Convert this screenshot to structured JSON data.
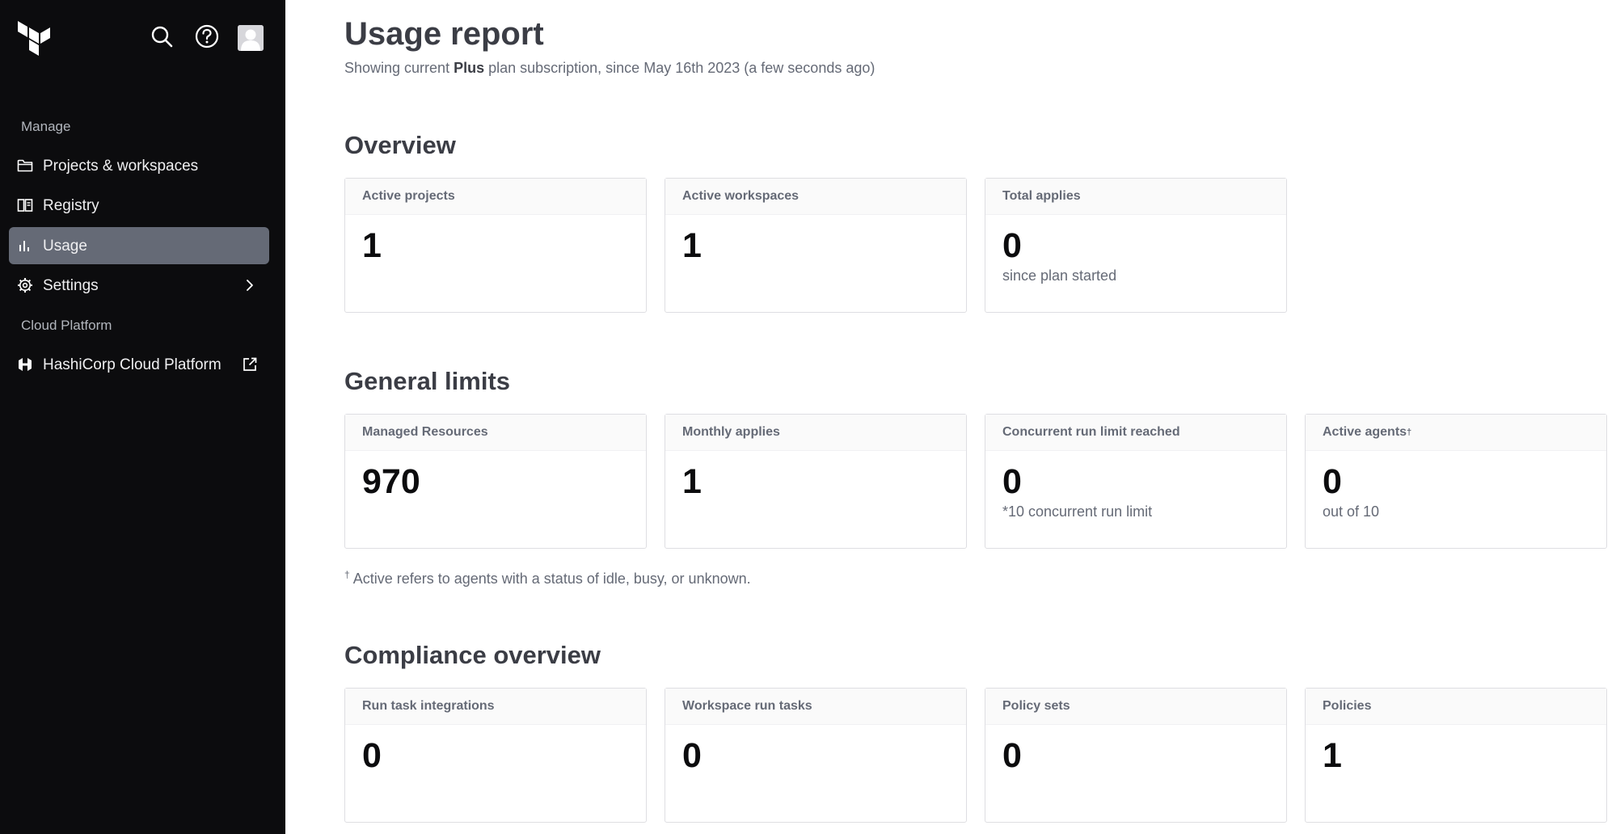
{
  "sidebar": {
    "manage_label": "Manage",
    "items": [
      {
        "label": "Projects & workspaces"
      },
      {
        "label": "Registry"
      },
      {
        "label": "Usage"
      },
      {
        "label": "Settings"
      }
    ],
    "cloud_label": "Cloud Platform",
    "cloud_item": {
      "label": "HashiCorp Cloud Platform"
    }
  },
  "header": {
    "title": "Usage report",
    "subtitle_prefix": "Showing current ",
    "plan": "Plus",
    "subtitle_suffix": " plan subscription, since May 16th 2023 (a few seconds ago)"
  },
  "overview": {
    "title": "Overview",
    "cards": [
      {
        "label": "Active projects",
        "value": "1",
        "note": ""
      },
      {
        "label": "Active workspaces",
        "value": "1",
        "note": ""
      },
      {
        "label": "Total applies",
        "value": "0",
        "note": "since plan started"
      }
    ]
  },
  "limits": {
    "title": "General limits",
    "cards": [
      {
        "label": "Managed Resources",
        "value": "970",
        "note": ""
      },
      {
        "label": "Monthly applies",
        "value": "1",
        "note": ""
      },
      {
        "label": "Concurrent run limit reached",
        "value": "0",
        "note": "*10 concurrent run limit"
      },
      {
        "label": "Active agents",
        "label_mark": "†",
        "value": "0",
        "note": "out of 10"
      }
    ],
    "footnote_mark": "†",
    "footnote": " Active refers to agents with a status of idle, busy, or unknown."
  },
  "compliance": {
    "title": "Compliance overview",
    "cards": [
      {
        "label": "Run task integrations",
        "value": "0"
      },
      {
        "label": "Workspace run tasks",
        "value": "0"
      },
      {
        "label": "Policy sets",
        "value": "0"
      },
      {
        "label": "Policies",
        "value": "1"
      }
    ]
  },
  "colors": {
    "sidebar_bg": "#0c0c0e",
    "active_item_bg": "#656a76",
    "card_header_bg": "#fafafa"
  }
}
